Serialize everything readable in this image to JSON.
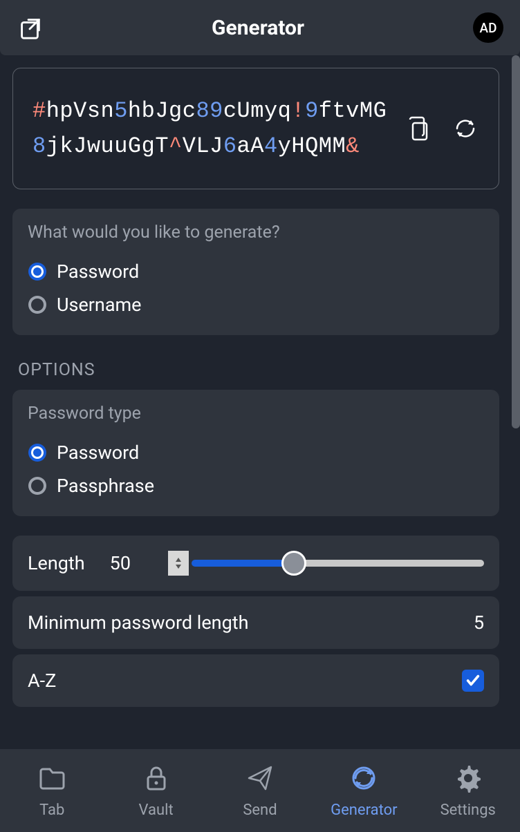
{
  "header": {
    "title": "Generator",
    "avatar_initials": "AD"
  },
  "password": {
    "segments": [
      {
        "text": "#",
        "class": "pw-special"
      },
      {
        "text": "hpVsn",
        "class": "pw-letter"
      },
      {
        "text": "5",
        "class": "pw-number"
      },
      {
        "text": "hbJgc",
        "class": "pw-letter"
      },
      {
        "text": "89",
        "class": "pw-number"
      },
      {
        "text": "cUmyq",
        "class": "pw-letter"
      },
      {
        "text": "!",
        "class": "pw-special"
      },
      {
        "text": "9",
        "class": "pw-number"
      },
      {
        "text": "ftvMG",
        "class": "pw-letter"
      },
      {
        "text": "8",
        "class": "pw-number"
      },
      {
        "text": "jkJwuuGgT",
        "class": "pw-letter"
      },
      {
        "text": "^",
        "class": "pw-special"
      },
      {
        "text": "VLJ",
        "class": "pw-letter"
      },
      {
        "text": "6",
        "class": "pw-number"
      },
      {
        "text": "aA",
        "class": "pw-letter"
      },
      {
        "text": "4",
        "class": "pw-number"
      },
      {
        "text": "yHQMM",
        "class": "pw-letter"
      },
      {
        "text": "&",
        "class": "pw-special"
      }
    ]
  },
  "generate_type": {
    "question": "What would you like to generate?",
    "options": [
      {
        "label": "Password",
        "selected": true
      },
      {
        "label": "Username",
        "selected": false
      }
    ]
  },
  "options_section_label": "OPTIONS",
  "password_type": {
    "label": "Password type",
    "options": [
      {
        "label": "Password",
        "selected": true
      },
      {
        "label": "Passphrase",
        "selected": false
      }
    ]
  },
  "length": {
    "label": "Length",
    "value": "50"
  },
  "min_length": {
    "label": "Minimum password length",
    "value": "5"
  },
  "az_option": {
    "label": "A-Z",
    "checked": true
  },
  "nav": {
    "items": [
      {
        "label": "Tab",
        "icon": "folder",
        "active": false
      },
      {
        "label": "Vault",
        "icon": "lock",
        "active": false
      },
      {
        "label": "Send",
        "icon": "send",
        "active": false
      },
      {
        "label": "Generator",
        "icon": "refresh",
        "active": true
      },
      {
        "label": "Settings",
        "icon": "gear",
        "active": false
      }
    ]
  }
}
